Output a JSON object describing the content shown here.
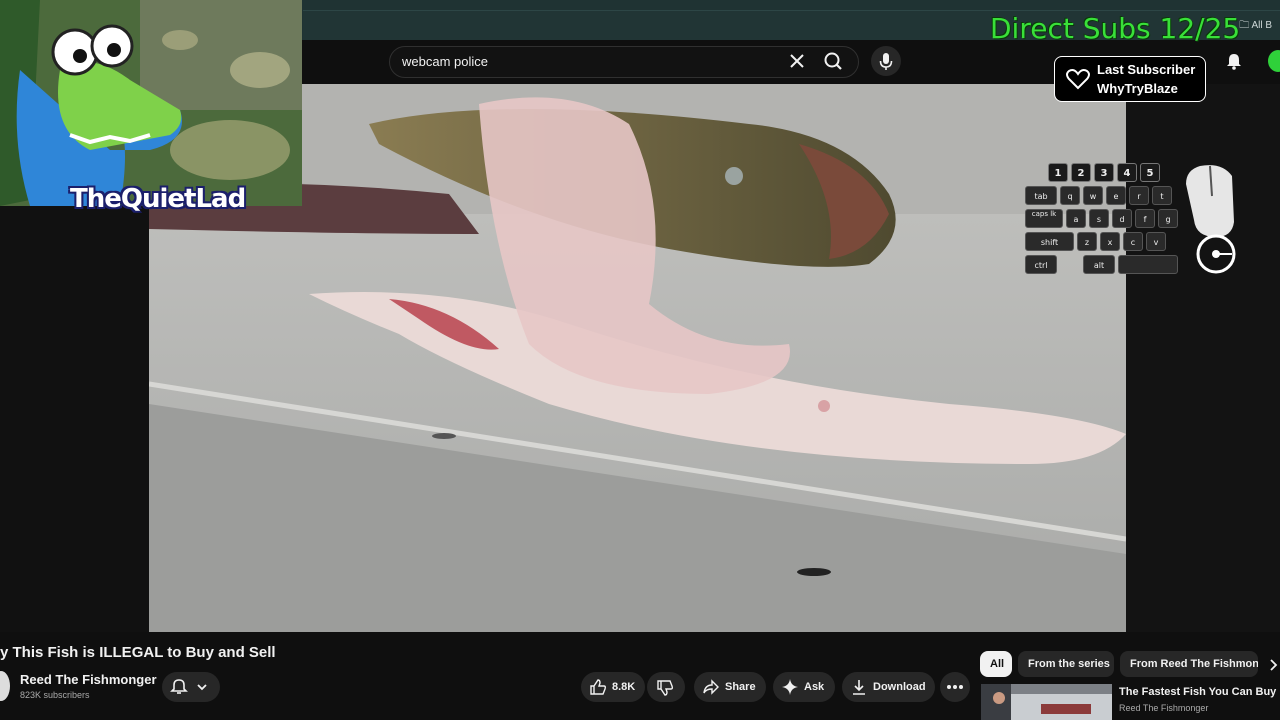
{
  "browser": {
    "bookmarks_label": "All B"
  },
  "search": {
    "query": "webcam police"
  },
  "overlay": {
    "channel_name": "TheQuietLad",
    "subs_goal": "Direct Subs 12/25",
    "last_subscriber_label": "Last Subscriber",
    "last_subscriber_name": "WhyTryBlaze"
  },
  "keyboard": {
    "number_keys": [
      "1",
      "2",
      "3",
      "4",
      "5"
    ],
    "row1": [
      "tab",
      "q",
      "w",
      "e",
      "r",
      "t"
    ],
    "row2": [
      "caps lk",
      "a",
      "s",
      "d",
      "f",
      "g"
    ],
    "row3": [
      "shift",
      "z",
      "x",
      "c",
      "v"
    ],
    "row4": [
      "ctrl",
      "alt"
    ]
  },
  "video": {
    "title": "y This Fish is ILLEGAL to Buy and Sell",
    "channel": "Reed The Fishmonger",
    "subscribers": "823K subscribers",
    "likes": "8.8K",
    "share_label": "Share",
    "ask_label": "Ask",
    "download_label": "Download"
  },
  "chips": [
    "All",
    "From the series",
    "From Reed The Fishmonger"
  ],
  "recommendation": {
    "title": "The Fastest Fish You Can Buy",
    "channel": "Reed The Fishmonger"
  },
  "colors": {
    "subs_green": "#39e039",
    "status_dot": "#2fd13a"
  }
}
